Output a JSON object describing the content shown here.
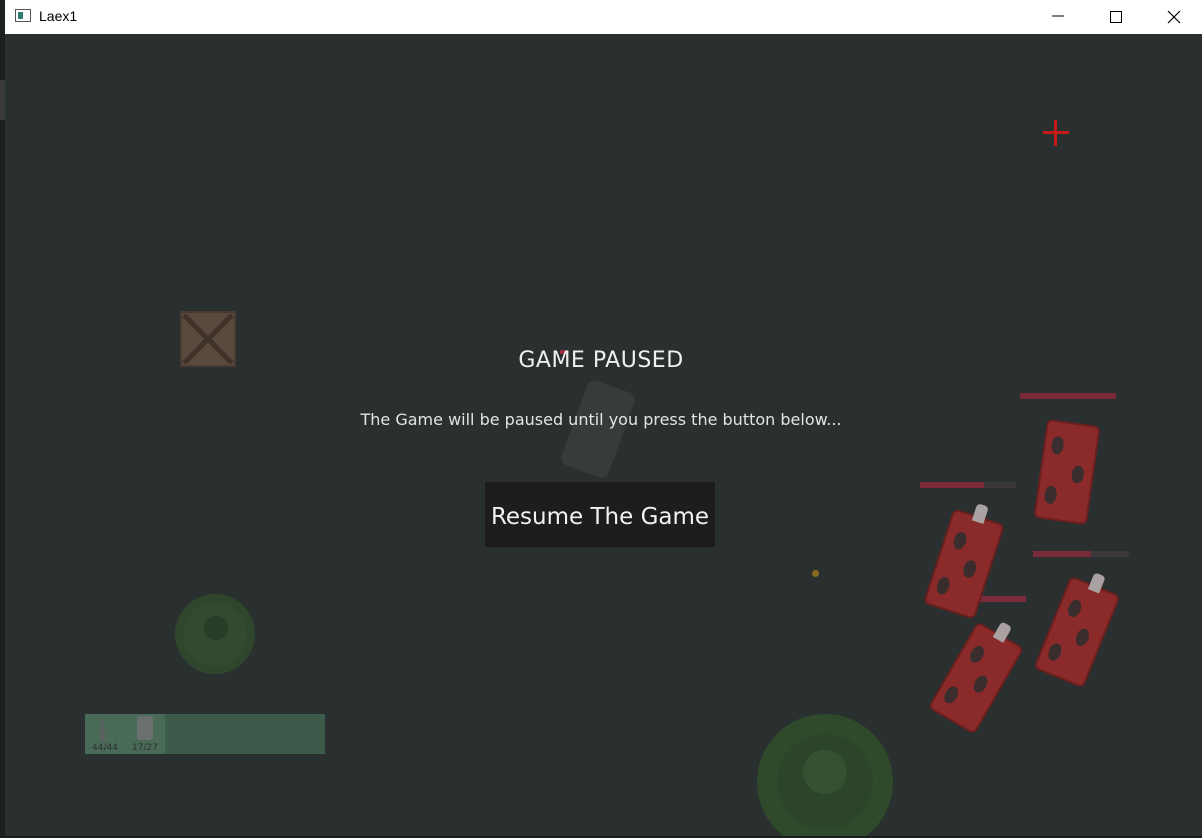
{
  "window": {
    "title": "Laex1",
    "controls": [
      "minimize",
      "maximize",
      "close"
    ]
  },
  "pause_menu": {
    "title": "GAME PAUSED",
    "message": "The Game will be paused until you press the button below...",
    "resume_label": "Resume The Game"
  },
  "hotbar": {
    "slots": [
      {
        "item": "knife-icon",
        "ammo": "44/44"
      },
      {
        "item": "canister-icon",
        "ammo": "17/27"
      }
    ]
  },
  "enemies": [
    {
      "name": "enemy-1",
      "health_fraction": 1.0
    },
    {
      "name": "enemy-2",
      "health_fraction": 0.67
    },
    {
      "name": "enemy-3",
      "health_fraction": 0.6
    },
    {
      "name": "enemy-4",
      "health_fraction": 1.0
    }
  ],
  "colors": {
    "background": "#2a2f2f",
    "crosshair": "#c41a1a",
    "enemy": "#8a2a2a",
    "health": "#7a2a38",
    "button": "#1d1d1d"
  }
}
